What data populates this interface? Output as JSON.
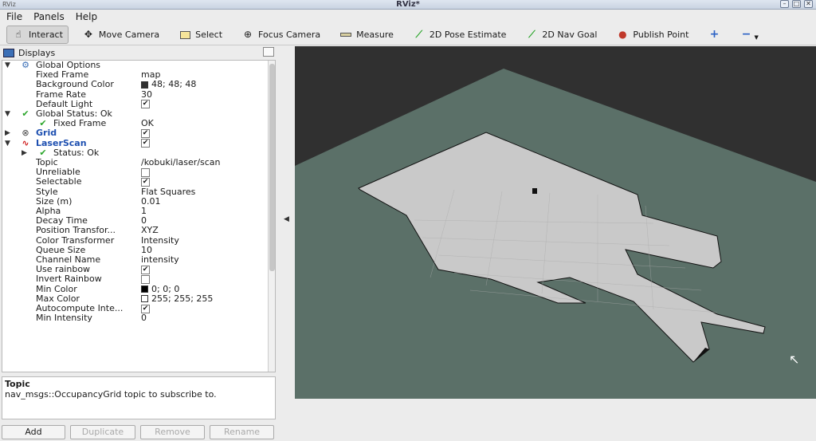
{
  "window": {
    "title": "RViz*",
    "app_label": "RViz",
    "controls": [
      "–",
      "□",
      "✕"
    ]
  },
  "menu": {
    "file": "File",
    "panels": "Panels",
    "help": "Help"
  },
  "toolbar": {
    "interact": "Interact",
    "move_camera": "Move Camera",
    "select": "Select",
    "focus_camera": "Focus Camera",
    "measure": "Measure",
    "pose_estimate": "2D Pose Estimate",
    "nav_goal": "2D Nav Goal",
    "publish_point": "Publish Point",
    "add_tool": "+",
    "remove_tool": "−"
  },
  "displays": {
    "title": "Displays",
    "rows": {
      "global_options": "Global Options",
      "fixed_frame_label": "Fixed Frame",
      "fixed_frame_value": "map",
      "background_color_label": "Background Color",
      "background_color_value": "48; 48; 48",
      "frame_rate_label": "Frame Rate",
      "frame_rate_value": "30",
      "default_light_label": "Default Light",
      "global_status": "Global Status: Ok",
      "gs_fixed_frame_label": "Fixed Frame",
      "gs_fixed_frame_value": "OK",
      "grid": "Grid",
      "laserscan": "LaserScan",
      "status": "Status: Ok",
      "topic_label": "Topic",
      "topic_value": "/kobuki/laser/scan",
      "unreliable_label": "Unreliable",
      "selectable_label": "Selectable",
      "style_label": "Style",
      "style_value": "Flat Squares",
      "size_label": "Size (m)",
      "size_value": "0.01",
      "alpha_label": "Alpha",
      "alpha_value": "1",
      "decay_label": "Decay Time",
      "decay_value": "0",
      "pos_tf_label": "Position Transfor...",
      "pos_tf_value": "XYZ",
      "color_tf_label": "Color Transformer",
      "color_tf_value": "Intensity",
      "queue_label": "Queue Size",
      "queue_value": "10",
      "channel_label": "Channel Name",
      "channel_value": "intensity",
      "use_rainbow_label": "Use rainbow",
      "invert_rainbow_label": "Invert Rainbow",
      "min_color_label": "Min Color",
      "min_color_value": "0; 0; 0",
      "max_color_label": "Max Color",
      "max_color_value": "255; 255; 255",
      "autocompute_label": "Autocompute Inte...",
      "min_intensity_label": "Min Intensity",
      "min_intensity_value": "0"
    },
    "colors": {
      "background": "#303030",
      "min": "#000000",
      "max": "#ffffff"
    }
  },
  "description": {
    "title": "Topic",
    "text": "nav_msgs::OccupancyGrid topic to subscribe to."
  },
  "buttons": {
    "add": "Add",
    "duplicate": "Duplicate",
    "remove": "Remove",
    "rename": "Rename"
  },
  "icons": [
    "monitor-icon",
    "gear-icon",
    "check-icon",
    "grid-icon",
    "laserscan-icon",
    "hand-icon",
    "move-icon",
    "select-icon",
    "focus-icon",
    "ruler-icon",
    "arrow-icon",
    "pin-icon",
    "plus-icon",
    "minus-icon"
  ]
}
